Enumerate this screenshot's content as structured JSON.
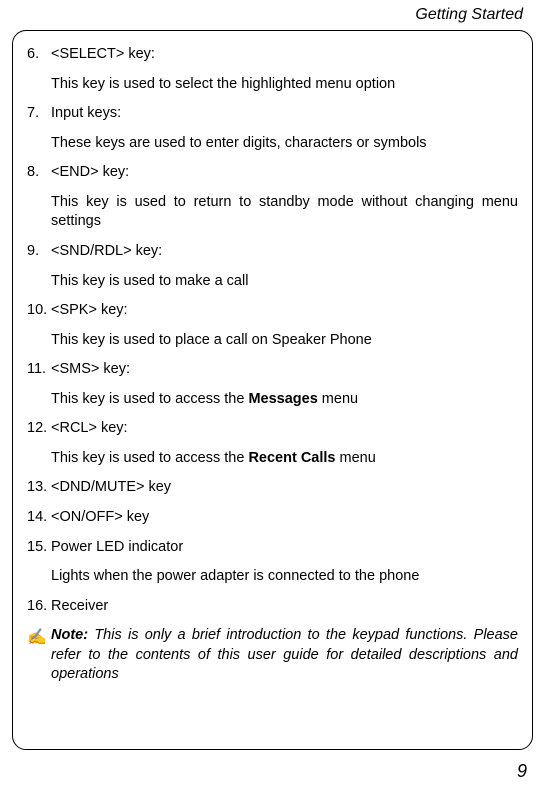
{
  "header_title": "Getting Started",
  "items": [
    {
      "num": "6.",
      "title": "<SELECT> key:",
      "desc_plain": "This key is used to select the highlighted menu option"
    },
    {
      "num": "7.",
      "title": "Input keys:",
      "desc_plain": "These keys are used to enter digits, characters or symbols"
    },
    {
      "num": "8.",
      "title": "<END> key:",
      "desc_plain": "This key is used to return to standby mode without changing menu settings"
    },
    {
      "num": "9.",
      "title": "<SND/RDL> key:",
      "desc_plain": "This key is used to make a call"
    },
    {
      "num": "10.",
      "title": "<SPK> key:",
      "desc_plain": "This key is used to place a call on Speaker Phone"
    },
    {
      "num": "11.",
      "title": "<SMS> key:",
      "desc_pre": "This key is used to access the ",
      "desc_bold": "Messages",
      "desc_post": " menu"
    },
    {
      "num": "12.",
      "title": "<RCL> key:",
      "desc_pre": "This key is used to access the ",
      "desc_bold": "Recent Calls",
      "desc_post": " menu"
    },
    {
      "num": "13.",
      "title": "<DND/MUTE> key"
    },
    {
      "num": "14.",
      "title": "<ON/OFF> key"
    },
    {
      "num": "15.",
      "title": "Power LED indicator",
      "desc_plain": "Lights when the power adapter is connected to the phone"
    },
    {
      "num": "16.",
      "title": "Receiver"
    }
  ],
  "note_icon": "✍",
  "note_label": "Note:",
  "note_body": " This is only a brief introduction to the keypad functions. Please refer to the contents of this user guide for detailed descriptions and operations",
  "page_number": "9"
}
